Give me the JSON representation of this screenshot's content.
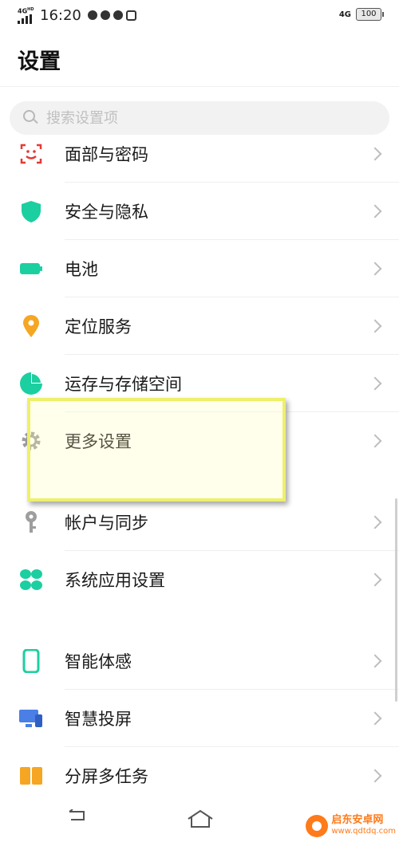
{
  "status_bar": {
    "network_left": "4G",
    "network_left_sup": "HD",
    "time": "16:20",
    "network_right": "4G",
    "battery": "100"
  },
  "page": {
    "title": "设置",
    "search_placeholder": "搜索设置项"
  },
  "settings_items": [
    {
      "label": "面部与密码",
      "icon": "face-scan-icon",
      "color": "#e53935"
    },
    {
      "label": "安全与隐私",
      "icon": "shield-icon",
      "color": "#1ccfa0"
    },
    {
      "label": "电池",
      "icon": "battery-icon",
      "color": "#1ccfa0"
    },
    {
      "label": "定位服务",
      "icon": "location-pin-icon",
      "color": "#f5a623"
    },
    {
      "label": "运存与存储空间",
      "icon": "pie-chart-icon",
      "color": "#1ccfa0"
    },
    {
      "label": "更多设置",
      "icon": "gear-icon",
      "color": "#9e9e9e"
    },
    {
      "label": "帐户与同步",
      "icon": "key-icon",
      "color": "#9e9e9e"
    },
    {
      "label": "系统应用设置",
      "icon": "apps-grid-icon",
      "color": "#1ccfa0"
    },
    {
      "label": "智能体感",
      "icon": "phone-motion-icon",
      "color": "#1ccfa0"
    },
    {
      "label": "智慧投屏",
      "icon": "screen-cast-icon",
      "color": "#4a7fe6"
    },
    {
      "label": "分屏多任务",
      "icon": "split-screen-icon",
      "color": "#f5a623"
    }
  ],
  "navigation": {
    "back_icon": "back-icon",
    "home_icon": "home-icon"
  },
  "watermark": {
    "name": "启东安卓网",
    "url": "www.qdtdq.com"
  }
}
